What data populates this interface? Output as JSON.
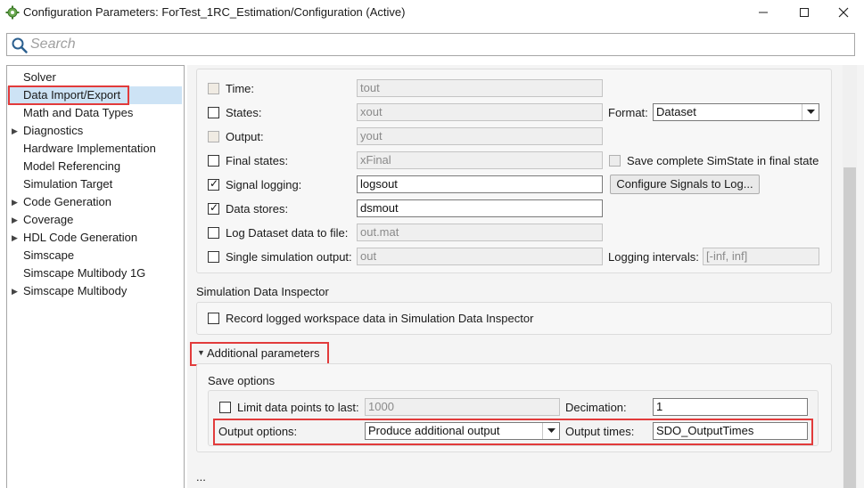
{
  "window": {
    "title": "Configuration Parameters: ForTest_1RC_Estimation/Configuration (Active)",
    "icons": {
      "app": "gear-icon",
      "minimize": "minimize-icon",
      "maximize": "maximize-icon",
      "close": "close-icon"
    }
  },
  "search": {
    "placeholder": "Search",
    "value": ""
  },
  "tree": {
    "items": [
      {
        "label": "Solver",
        "expandable": false,
        "selected": false
      },
      {
        "label": "Data Import/Export",
        "expandable": false,
        "selected": true
      },
      {
        "label": "Math and Data Types",
        "expandable": false,
        "selected": false
      },
      {
        "label": "Diagnostics",
        "expandable": true,
        "selected": false
      },
      {
        "label": "Hardware Implementation",
        "expandable": false,
        "selected": false
      },
      {
        "label": "Model Referencing",
        "expandable": false,
        "selected": false
      },
      {
        "label": "Simulation Target",
        "expandable": false,
        "selected": false
      },
      {
        "label": "Code Generation",
        "expandable": true,
        "selected": false
      },
      {
        "label": "Coverage",
        "expandable": true,
        "selected": false
      },
      {
        "label": "HDL Code Generation",
        "expandable": true,
        "selected": false
      },
      {
        "label": "Simscape",
        "expandable": false,
        "selected": false
      },
      {
        "label": "Simscape Multibody 1G",
        "expandable": false,
        "selected": false
      },
      {
        "label": "Simscape Multibody",
        "expandable": true,
        "selected": false
      }
    ]
  },
  "save_to_workspace": {
    "time": {
      "label": "Time:",
      "value": "tout",
      "checked": false
    },
    "states": {
      "label": "States:",
      "value": "xout",
      "checked": false
    },
    "output": {
      "label": "Output:",
      "value": "yout",
      "checked": false
    },
    "final_states": {
      "label": "Final states:",
      "value": "xFinal",
      "checked": false
    },
    "signal_logging": {
      "label": "Signal logging:",
      "value": "logsout",
      "checked": true
    },
    "data_stores": {
      "label": "Data stores:",
      "value": "dsmout",
      "checked": true
    },
    "log_dataset": {
      "label": "Log Dataset data to file:",
      "value": "out.mat",
      "checked": false
    },
    "single_output": {
      "label": "Single simulation output:",
      "value": "out",
      "checked": false
    },
    "format": {
      "label": "Format:",
      "value": "Dataset"
    },
    "save_simstate": {
      "label": "Save complete SimState in final state",
      "checked": false
    },
    "configure_button": "Configure Signals to Log...",
    "logging_intervals": {
      "label": "Logging intervals:",
      "value": "[-inf, inf]"
    }
  },
  "sdi": {
    "title": "Simulation Data Inspector",
    "record": {
      "label": "Record logged workspace data in Simulation Data Inspector",
      "checked": false
    }
  },
  "additional": {
    "toggle_label": "Additional parameters",
    "save_options_title": "Save options",
    "limit": {
      "label": "Limit data points to last:",
      "value": "1000",
      "checked": false
    },
    "decimation": {
      "label": "Decimation:",
      "value": "1"
    },
    "output_options": {
      "label": "Output options:",
      "value": "Produce additional output"
    },
    "output_times": {
      "label": "Output times:",
      "value": "SDO_OutputTimes"
    },
    "ellipsis": "..."
  },
  "colors": {
    "highlight_box": "#e23b3b",
    "selection": "#cde3f5"
  }
}
